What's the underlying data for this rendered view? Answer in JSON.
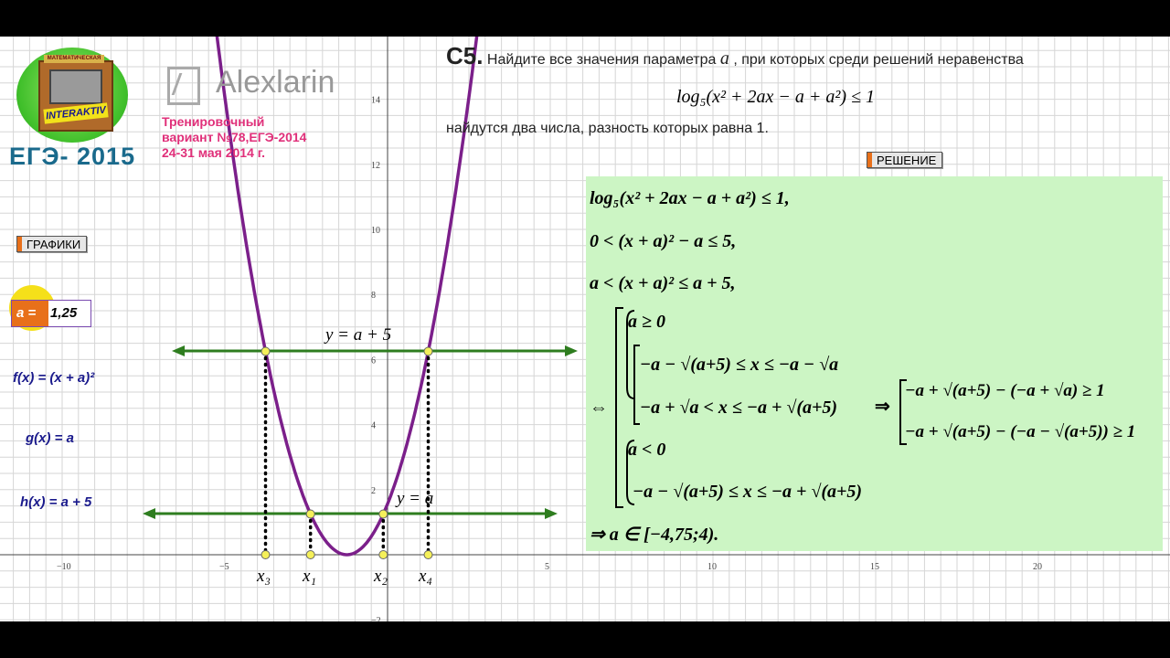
{
  "logo": {
    "badge_small": "МАТЕМАТИЧЕСКАЯ",
    "badge_big": "INTERAKTIV",
    "exam": "ЕГЭ- 2015"
  },
  "watermark": {
    "brand": "Alexlarin"
  },
  "variant": {
    "line1": "Тренировочный",
    "line2": "вариант №78,ЕГЭ-2014",
    "line3": "24-31 мая 2014 г."
  },
  "problem": {
    "id": "С5.",
    "text_before": "Найдите все значения параметра",
    "param": "a",
    "text_after": ", при которых среди решений неравенства",
    "inequality": "log₅(x² + 2ax − a + a²) ≤ 1",
    "text_end": "найдутся два числа, разность которых равна 1."
  },
  "buttons": {
    "solution": "РЕШЕНИЕ",
    "graphs": "ГРАФИКИ"
  },
  "slider": {
    "label": "a =",
    "value": "1,25"
  },
  "functions": {
    "f": "f(x) = (x + a)²",
    "g": "g(x) = a",
    "h": "h(x) = a + 5"
  },
  "graph_labels": {
    "upper_line": "y = a + 5",
    "lower_line": "y = a",
    "x3": "x₃",
    "x1": "x₁",
    "x2": "x₂",
    "x4": "x₄"
  },
  "axes": {
    "x_ticks": [
      "−10",
      "−5",
      "5",
      "10",
      "15",
      "20"
    ],
    "y_ticks": [
      "14",
      "12",
      "10",
      "8",
      "6",
      "4",
      "2",
      "−2"
    ]
  },
  "solution": {
    "line1": "log₅(x² + 2ax − a + a²) ≤ 1,",
    "line2": "0 < (x + a)² − a ≤ 5,",
    "line3": "a < (x + a)² ≤ a + 5,",
    "c1": "a ≥ 0",
    "c2": "−a − √(a+5) ≤ x ≤ −a − √a",
    "c3": "−a + √a < x ≤ −a + √(a+5)",
    "arrow": "⇔",
    "c4": "a < 0",
    "c5": "−a − √(a+5) ≤ x ≤ −a + √(a+5)",
    "implies": "⇒",
    "r1": "−a + √(a+5) − (−a + √a) ≥ 1",
    "r2": "−a + √(a+5) − (−a − √(a+5)) ≥ 1",
    "final": "⇒ a ∈ [−4,75;4)."
  },
  "colors": {
    "curve": "#7b1f8a",
    "lines": "#2e7d1f",
    "solution_bg": "#ccf5c4",
    "accent": "#e8701a",
    "pink": "#e0307a",
    "points": "#f5f05a"
  },
  "graph_state": {
    "a": 1.25
  }
}
